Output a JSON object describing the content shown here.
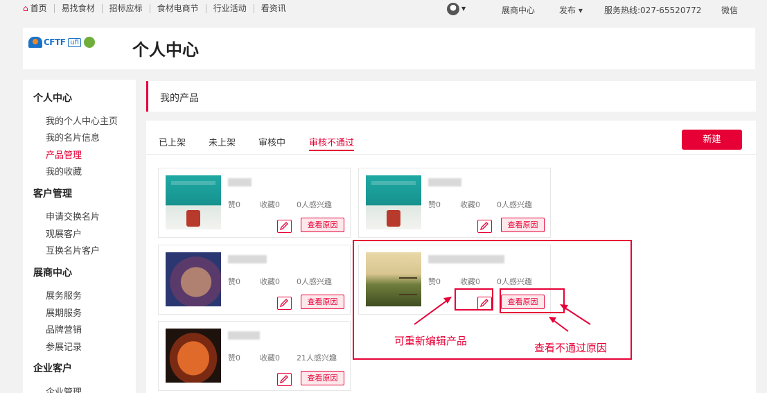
{
  "topbar": {
    "home": "首页",
    "links": [
      "易找食材",
      "招标应标",
      "食材电商节",
      "行业活动",
      "看资讯"
    ],
    "exhibitor_center": "展商中心",
    "publish": "发布",
    "publish_caret": "▾",
    "hotline": "服务热线:027-65520772",
    "wechat": "微信"
  },
  "header": {
    "logo_text": "CFTF",
    "logo_ufi": "ufi",
    "page_title": "个人中心"
  },
  "sidebar": {
    "groups": [
      {
        "title": "个人中心",
        "items": [
          "我的个人中心主页",
          "我的名片信息",
          "产品管理",
          "我的收藏"
        ]
      },
      {
        "title": "客户管理",
        "items": [
          "申请交换名片",
          "观展客户",
          "互换名片客户"
        ]
      },
      {
        "title": "展商中心",
        "items": [
          "展务服务",
          "展期服务",
          "品牌营销",
          "参展记录"
        ]
      },
      {
        "title": "企业客户",
        "items": [
          "企业管理"
        ]
      }
    ],
    "active_item": "产品管理"
  },
  "main": {
    "section_title": "我的产品",
    "tabs": [
      "已上架",
      "未上架",
      "审核中",
      "审核不通过"
    ],
    "active_tab": "审核不通过",
    "new_button": "新建",
    "products": [
      {
        "likes": "赞0",
        "favorites": "收藏0",
        "interest": "0人感兴趣",
        "reason_button": "查看原因"
      },
      {
        "likes": "赞0",
        "favorites": "收藏0",
        "interest": "0人感兴趣",
        "reason_button": "查看原因"
      },
      {
        "likes": "赞0",
        "favorites": "收藏0",
        "interest": "0人感兴趣",
        "reason_button": "查看原因"
      },
      {
        "likes": "赞0",
        "favorites": "收藏0",
        "interest": "0人感兴趣",
        "reason_button": "查看原因"
      },
      {
        "likes": "赞0",
        "favorites": "收藏0",
        "interest": "21人感兴趣",
        "reason_button": "查看原因"
      }
    ]
  },
  "annotations": {
    "edit_hint": "可重新编辑产品",
    "reason_hint": "查看不通过原因"
  },
  "colors": {
    "accent": "#e60036"
  }
}
